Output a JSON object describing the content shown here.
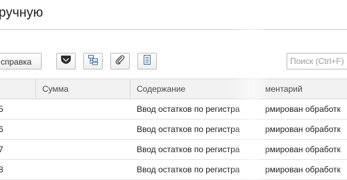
{
  "page": {
    "title": "ручную"
  },
  "toolbar": {
    "help_label": "справка",
    "icons": [
      "shield-icon",
      "structure-icon",
      "paperclip-icon",
      "document-list-icon"
    ],
    "search_placeholder": "Поиск (Ctrl+F)"
  },
  "table": {
    "columns": [
      "",
      "Сумма",
      "Содержание",
      "ментарий"
    ],
    "rows": [
      {
        "num": "5",
        "sum": "",
        "content": "Ввод остатков по регистра",
        "comment": "рмирован обработк"
      },
      {
        "num": "6",
        "sum": "",
        "content": "Ввод остатков по регистра",
        "comment": "рмирован обработк"
      },
      {
        "num": "7",
        "sum": "",
        "content": "Ввод остатков по регистра",
        "comment": "рмирован обработк"
      },
      {
        "num": "8",
        "sum": "",
        "content": "Ввод остатков по регистра",
        "comment": "рмирован обработк"
      }
    ]
  }
}
